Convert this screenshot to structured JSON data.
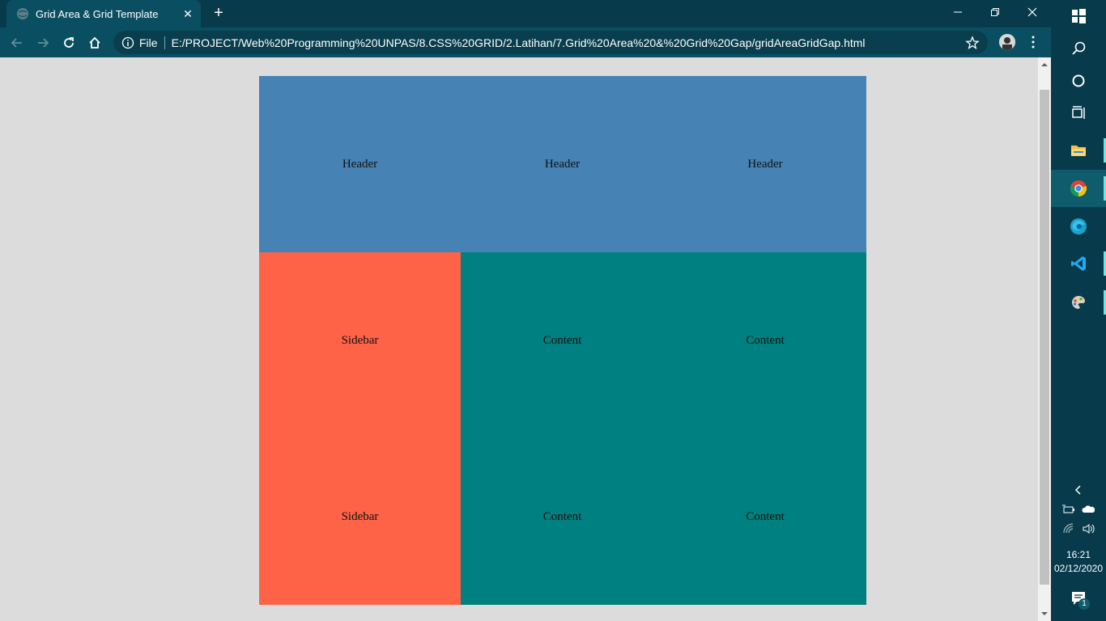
{
  "browser": {
    "tab_title": "Grid Area & Grid Template",
    "address": {
      "scheme_label": "File",
      "url": "E:/PROJECT/Web%20Programming%20UNPAS/8.CSS%20GRID/2.Latihan/7.Grid%20Area%20&%20Grid%20Gap/gridAreaGridGap.html"
    }
  },
  "page": {
    "header": [
      "Header",
      "Header",
      "Header"
    ],
    "row2": {
      "sidebar": "Sidebar",
      "content": [
        "Content",
        "Content"
      ]
    },
    "row3": {
      "sidebar": "Sidebar",
      "content": [
        "Content",
        "Content"
      ]
    },
    "colors": {
      "header": "#4682b4",
      "sidebar": "#ff6347",
      "content": "#008080",
      "background": "#dcdcdc"
    }
  },
  "taskbar": {
    "accent": "#073b4c",
    "time": "16:21",
    "date": "02/12/2020",
    "notification_count": "1"
  }
}
